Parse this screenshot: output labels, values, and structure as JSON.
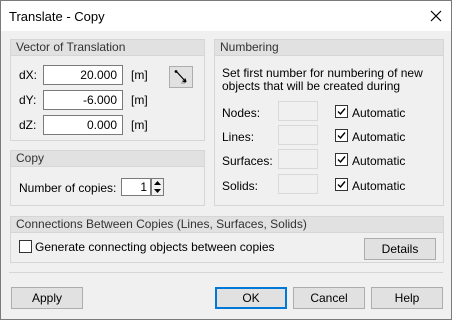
{
  "window": {
    "title": "Translate - Copy"
  },
  "vector": {
    "header": "Vector of Translation",
    "rows": [
      {
        "label": "dX:",
        "value": "20.000",
        "unit": "[m]"
      },
      {
        "label": "dY:",
        "value": "-6.000",
        "unit": "[m]"
      },
      {
        "label": "dZ:",
        "value": "0.000",
        "unit": "[m]"
      }
    ]
  },
  "copy": {
    "header": "Copy",
    "label": "Number of copies:",
    "value": "1"
  },
  "numbering": {
    "header": "Numbering",
    "description": "Set first number for numbering of new objects that will be created during",
    "rows": [
      {
        "label": "Nodes:",
        "auto_label": "Automatic",
        "checked": true
      },
      {
        "label": "Lines:",
        "auto_label": "Automatic",
        "checked": true
      },
      {
        "label": "Surfaces:",
        "auto_label": "Automatic",
        "checked": true
      },
      {
        "label": "Solids:",
        "auto_label": "Automatic",
        "checked": true
      }
    ]
  },
  "connections": {
    "header": "Connections Between Copies (Lines, Surfaces, Solids)",
    "checkbox_label": "Generate connecting objects between copies",
    "checked": false,
    "details_label": "Details"
  },
  "footer": {
    "apply_label": "Apply",
    "ok_label": "OK",
    "cancel_label": "Cancel",
    "help_label": "Help"
  }
}
